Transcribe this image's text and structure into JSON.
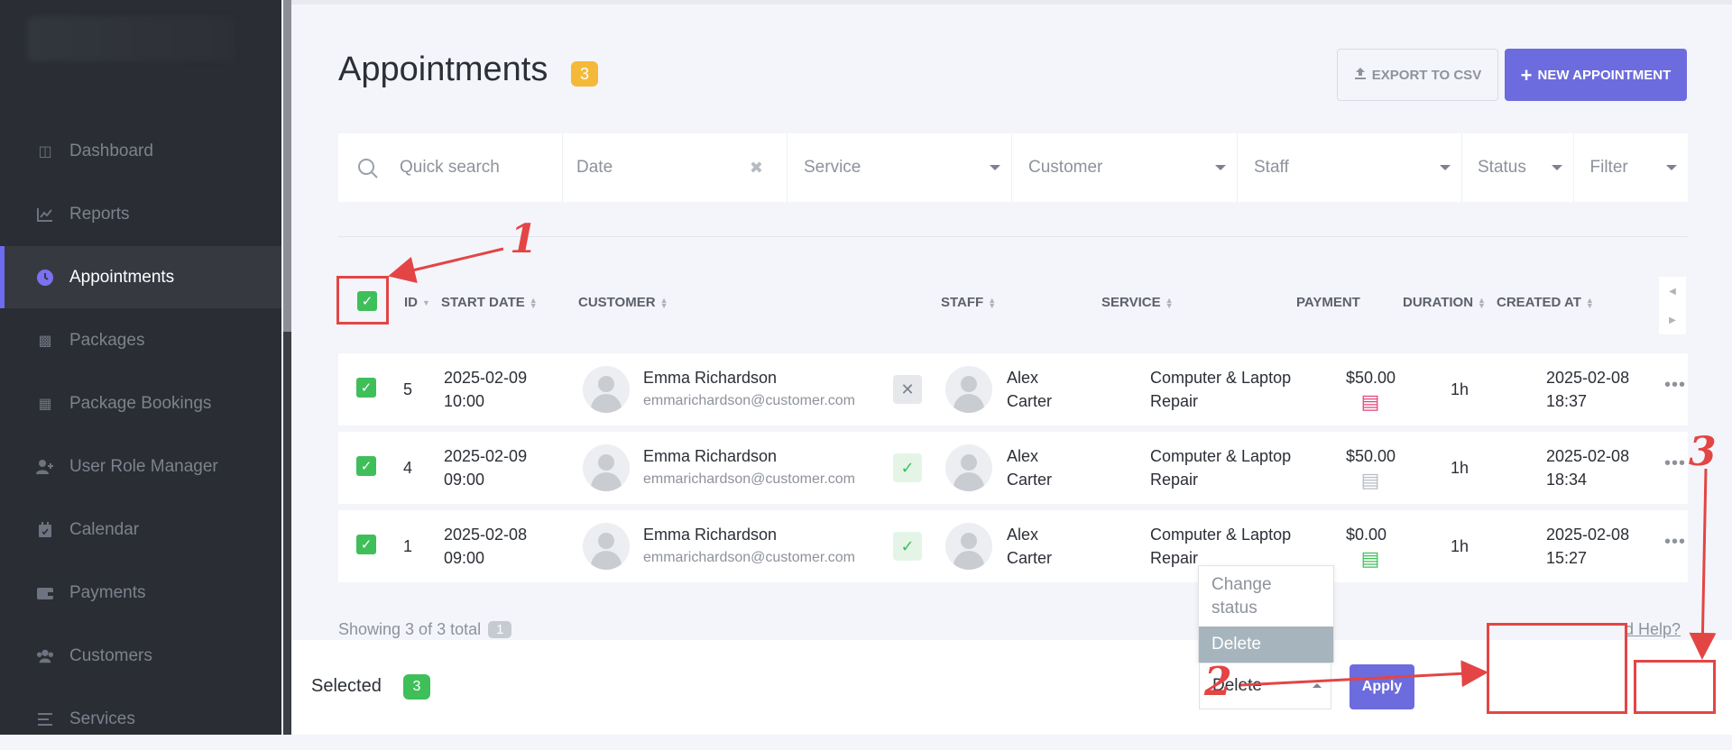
{
  "sidebar": {
    "items": [
      {
        "label": "Dashboard",
        "icon": "cube-icon",
        "active": false
      },
      {
        "label": "Reports",
        "icon": "line-chart-icon",
        "active": false
      },
      {
        "label": "Appointments",
        "icon": "clock-icon",
        "active": true
      },
      {
        "label": "Packages",
        "icon": "boxes-icon",
        "active": false
      },
      {
        "label": "Package Bookings",
        "icon": "package-booking-icon",
        "active": false
      },
      {
        "label": "User Role Manager",
        "icon": "user-plus-icon",
        "active": false
      },
      {
        "label": "Calendar",
        "icon": "calendar-icon",
        "active": false
      },
      {
        "label": "Payments",
        "icon": "wallet-icon",
        "active": false
      },
      {
        "label": "Customers",
        "icon": "users-icon",
        "active": false
      },
      {
        "label": "Services",
        "icon": "list-icon",
        "active": false
      }
    ]
  },
  "header": {
    "title": "Appointments",
    "count": "3",
    "export_label": "EXPORT TO CSV",
    "new_label": "NEW APPOINTMENT"
  },
  "filters": {
    "search_placeholder": "Quick search",
    "date": "Date",
    "service": "Service",
    "customer": "Customer",
    "staff": "Staff",
    "status": "Status",
    "filter": "Filter"
  },
  "table": {
    "columns": {
      "id": "ID",
      "start_date": "START DATE",
      "customer": "CUSTOMER",
      "staff": "STAFF",
      "service": "SERVICE",
      "payment": "PAYMENT",
      "duration": "DURATION",
      "created_at": "CREATED AT"
    },
    "rows": [
      {
        "id": "5",
        "date": "2025-02-09",
        "time": "10:00",
        "customer_name": "Emma Richardson",
        "customer_email": "emmarichardson@customer.com",
        "status": "cancelled",
        "staff_first": "Alex",
        "staff_last": "Carter",
        "service_l1": "Computer & Laptop",
        "service_l2": "Repair",
        "payment": "$50.00",
        "payment_status_color": "#e0457b",
        "duration": "1h",
        "created_date": "2025-02-08",
        "created_time": "18:37"
      },
      {
        "id": "4",
        "date": "2025-02-09",
        "time": "09:00",
        "customer_name": "Emma Richardson",
        "customer_email": "emmarichardson@customer.com",
        "status": "approved",
        "staff_first": "Alex",
        "staff_last": "Carter",
        "service_l1": "Computer & Laptop",
        "service_l2": "Repair",
        "payment": "$50.00",
        "payment_status_color": "#b6bcc4",
        "duration": "1h",
        "created_date": "2025-02-08",
        "created_time": "18:34"
      },
      {
        "id": "1",
        "date": "2025-02-08",
        "time": "09:00",
        "customer_name": "Emma Richardson",
        "customer_email": "emmarichardson@customer.com",
        "status": "approved",
        "staff_first": "Alex",
        "staff_last": "Carter",
        "service_l1": "Computer & Laptop",
        "service_l2": "Repair",
        "payment": "$0.00",
        "payment_status_color": "#3fbf5a",
        "duration": "1h",
        "created_date": "2025-02-08",
        "created_time": "15:27"
      }
    ]
  },
  "footer": {
    "showing": "Showing 3 of 3 total",
    "page": "1",
    "need_help": "d Help?"
  },
  "bulk": {
    "selected_label": "Selected",
    "selected_count": "3",
    "menu_option_1": "Change status",
    "menu_option_2": "Delete",
    "select_value": "Delete",
    "apply_label": "Apply"
  },
  "annotations": {
    "n1": "1",
    "n2": "2",
    "n3": "3"
  },
  "colors": {
    "accent": "#6c6cde",
    "sidebar_bg": "#2a2d33",
    "badge_orange": "#f5b93a",
    "check_green": "#3fbf5a",
    "annotation_red": "#e34545"
  }
}
